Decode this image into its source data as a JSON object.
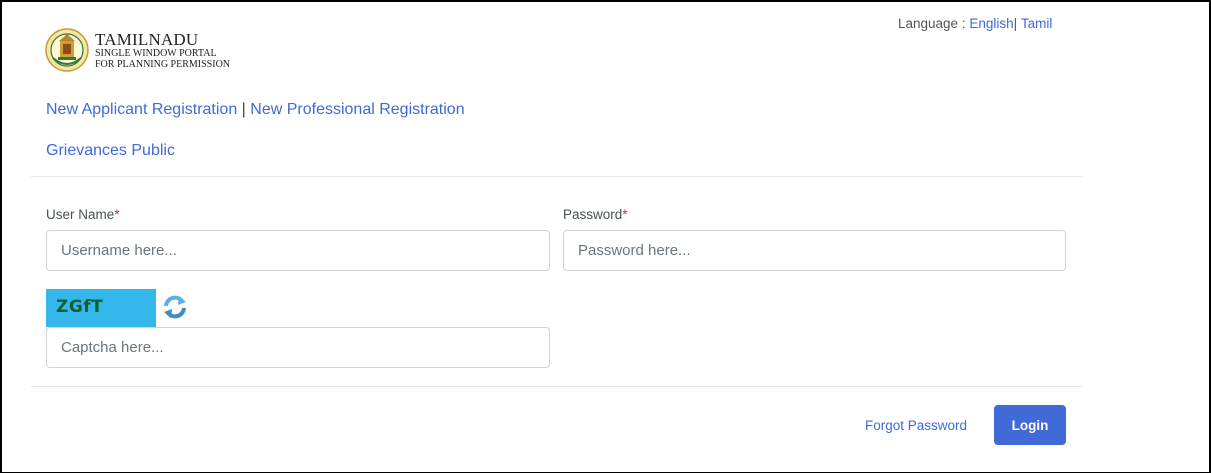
{
  "language": {
    "prefix": "Language : ",
    "english": "English",
    "separator": "|",
    "tamil": "Tamil"
  },
  "logo": {
    "title": "TAMILNADU",
    "line1": "SINGLE WINDOW PORTAL",
    "line2": "FOR PLANNING PERMISSION"
  },
  "nav": {
    "new_applicant": "New Applicant Registration",
    "separator": " | ",
    "new_professional": "New Professional Registration",
    "grievances": "Grievances Public"
  },
  "form": {
    "username_label": "User Name",
    "username_placeholder": "Username here...",
    "username_value": "",
    "password_label": "Password",
    "password_placeholder": "Password here...",
    "password_value": "",
    "required_mark": "*",
    "captcha_image_text": "ZGfT",
    "captcha_placeholder": "Captcha here...",
    "captcha_value": ""
  },
  "actions": {
    "forgot_password": "Forgot Password",
    "login": "Login"
  },
  "colors": {
    "link": "#3f6ad8",
    "primary_button": "#3f6ad8",
    "required": "#d92550",
    "captcha_bg": "#34b7ea",
    "captcha_text": "#0f5e2f"
  }
}
